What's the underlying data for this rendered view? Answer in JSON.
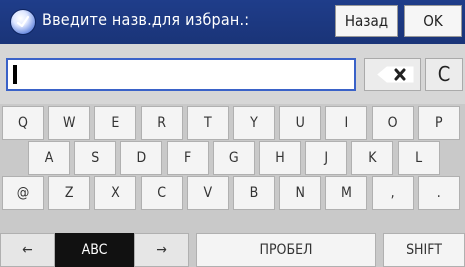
{
  "header": {
    "title": "Введите назв.для избран.:",
    "back_label": "Назад",
    "ok_label": "OK"
  },
  "input": {
    "value": "",
    "clear_label": "C"
  },
  "keyboard": {
    "row1": [
      "Q",
      "W",
      "E",
      "R",
      "T",
      "Y",
      "U",
      "I",
      "O",
      "P"
    ],
    "row2": [
      "A",
      "S",
      "D",
      "F",
      "G",
      "H",
      "J",
      "K",
      "L"
    ],
    "row3": [
      "@",
      "Z",
      "X",
      "C",
      "V",
      "B",
      "N",
      "M",
      ",",
      "."
    ],
    "bottom": {
      "left_arrow": "←",
      "mode": "ABC",
      "right_arrow": "→",
      "space": "ПРОБЕЛ",
      "shift": "SHIFT"
    }
  },
  "colors": {
    "header_bg": "#1f3d8a",
    "field_border": "#3a62c8",
    "active_mode_bg": "#111111"
  }
}
